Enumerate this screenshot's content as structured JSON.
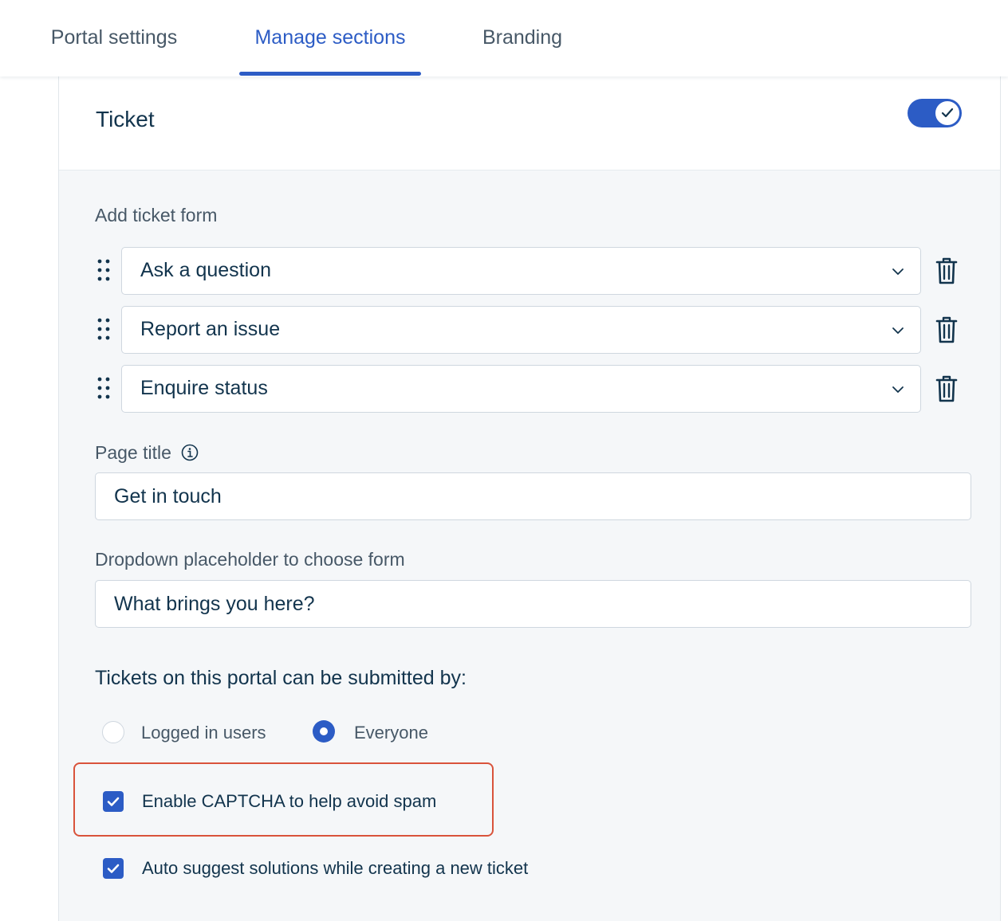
{
  "tabs": [
    {
      "label": "Portal settings"
    },
    {
      "label": "Manage sections"
    },
    {
      "label": "Branding"
    }
  ],
  "active_tab": "Manage sections",
  "section": {
    "title": "Ticket",
    "enabled": true,
    "add_form_label": "Add ticket form",
    "forms": [
      {
        "value": "Ask a question"
      },
      {
        "value": "Report an issue"
      },
      {
        "value": "Enquire status"
      }
    ],
    "page_title_label": "Page title",
    "page_title_value": "Get in touch",
    "dropdown_placeholder_label": "Dropdown placeholder to choose form",
    "dropdown_placeholder_value": "What brings you here?",
    "submitted_by_heading": "Tickets on this portal can be submitted by:",
    "radio_options": [
      {
        "label": "Logged in users",
        "selected": false
      },
      {
        "label": "Everyone",
        "selected": true
      }
    ],
    "captcha_label": "Enable CAPTCHA to help avoid spam",
    "captcha_checked": true,
    "auto_suggest_label": "Auto suggest solutions while creating a new ticket",
    "auto_suggest_checked": true
  },
  "colors": {
    "accent": "#2c5cc5",
    "highlight_border": "#d9533b",
    "text_primary": "#12344d",
    "text_secondary": "#475867"
  }
}
